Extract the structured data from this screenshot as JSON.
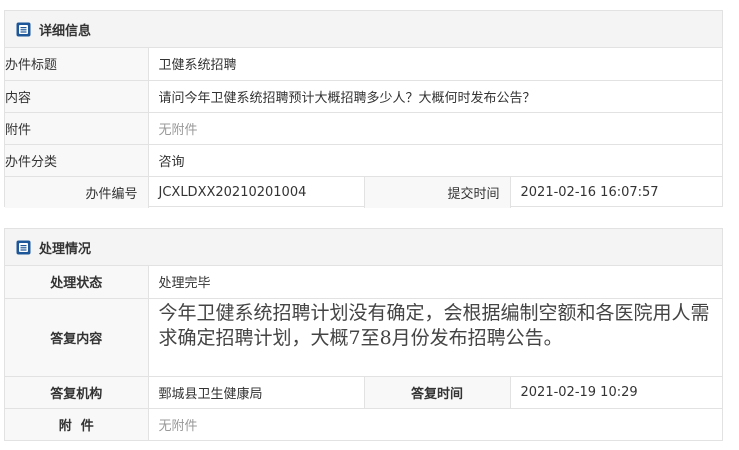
{
  "detail": {
    "title": "详细信息",
    "rows": {
      "subject_label": "办件标题",
      "subject_value": "卫健系统招聘",
      "content_label": "内容",
      "content_value": "请问今年卫健系统招聘预计大概招聘多少人？大概何时发布公告？",
      "attachment_label": "附件",
      "attachment_value": "无附件",
      "category_label": "办件分类",
      "category_value": "咨询",
      "number_label": "办件编号",
      "number_value": "JCXLDXX20210201004",
      "submit_time_label": "提交时间",
      "submit_time_value": "2021-02-16 16:07:57"
    }
  },
  "process": {
    "title": "处理情况",
    "rows": {
      "status_label": "处理状态",
      "status_value": "处理完毕",
      "reply_label": "答复内容",
      "reply_value": "今年卫健系统招聘计划没有确定，会根据编制空额和各医院用人需求确定招聘计划，大概7至8月份发布招聘公告。",
      "agency_label": "答复机构",
      "agency_value": "鄄城县卫生健康局",
      "reply_time_label": "答复时间",
      "reply_time_value": "2021-02-19 10:29",
      "attachment_label": "附  件",
      "attachment_value": "无附件"
    }
  },
  "colors": {
    "icon": "#1e5799",
    "border": "#e2e2e2",
    "header_bg": "#f4f4f4",
    "muted_text": "#999999"
  },
  "icons": {
    "section": "document-list-icon"
  }
}
